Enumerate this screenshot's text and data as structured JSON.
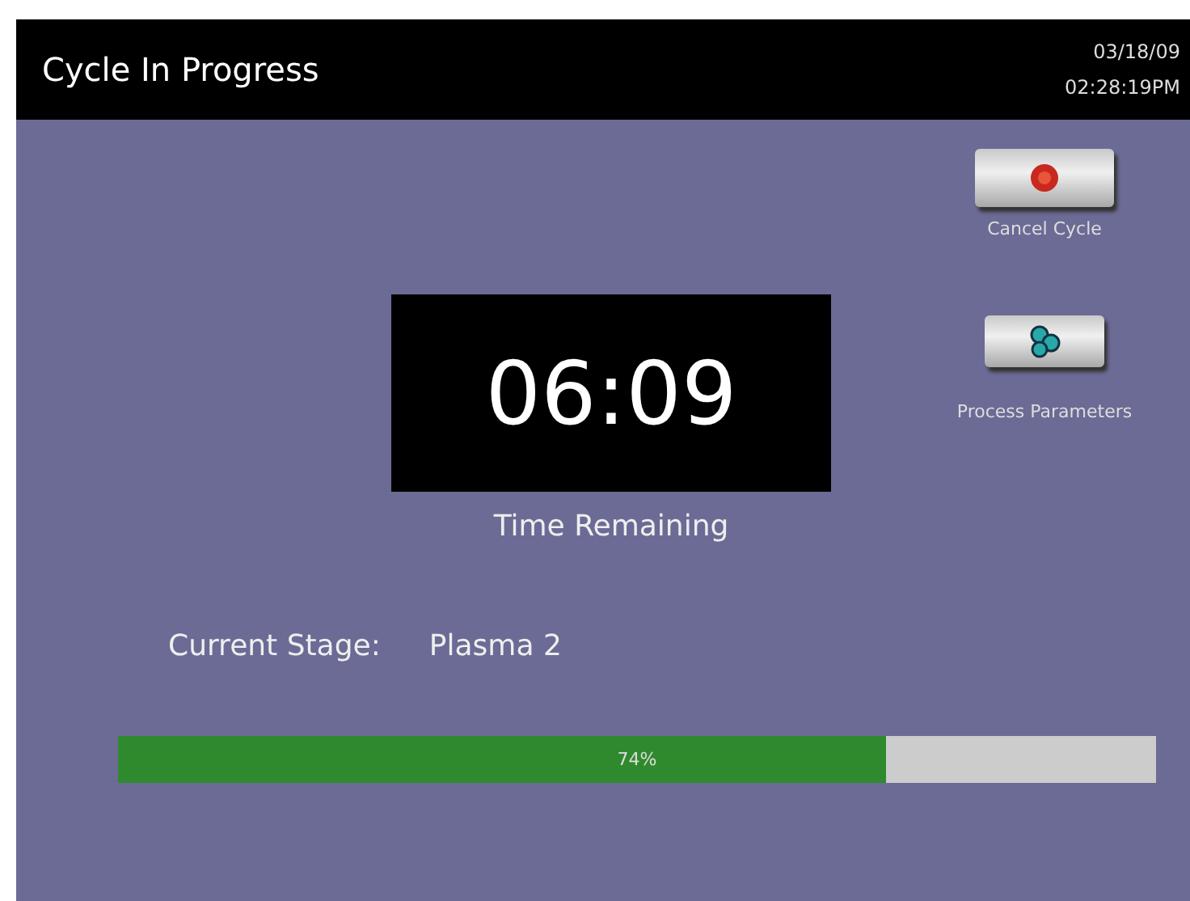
{
  "header": {
    "title": "Cycle In Progress",
    "date": "03/18/09",
    "time": "02:28:19PM"
  },
  "actions": [
    {
      "kind": "cancel",
      "label": "Cancel Cycle"
    },
    {
      "kind": "parameters",
      "label": "Process Parameters"
    }
  ],
  "timer": {
    "value": "06:09",
    "caption": "Time Remaining"
  },
  "stage": {
    "label": "Current Stage:",
    "value": "Plasma 2"
  },
  "progress": {
    "level": 0.74,
    "reading": "74%"
  }
}
